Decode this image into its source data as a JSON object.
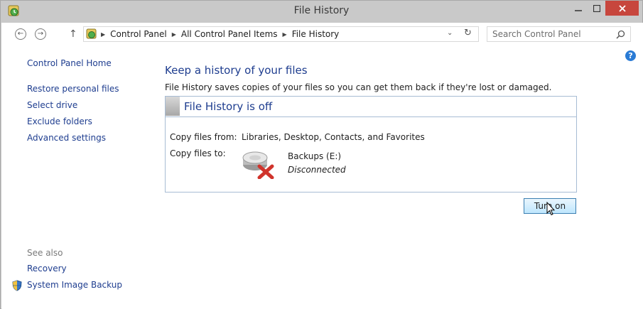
{
  "window": {
    "title": "File History"
  },
  "address": {
    "breadcrumbs": [
      "Control Panel",
      "All Control Panel Items",
      "File History"
    ],
    "search_placeholder": "Search Control Panel"
  },
  "sidebar": {
    "home": "Control Panel Home",
    "links": [
      "Restore personal files",
      "Select drive",
      "Exclude folders",
      "Advanced settings"
    ],
    "see_also_label": "See also",
    "see_also": [
      "Recovery",
      "System Image Backup"
    ]
  },
  "main": {
    "heading": "Keep a history of your files",
    "description": "File History saves copies of your files so you can get them back if they're lost or damaged.",
    "status_title": "File History is off",
    "copy_from_label": "Copy files from:",
    "copy_from_value": "Libraries, Desktop, Contacts, and Favorites",
    "copy_to_label": "Copy files to:",
    "drive_name": "Backups (E:)",
    "drive_status": "Disconnected",
    "turn_on_label": "Turn on"
  },
  "icons": {
    "app": "file-history-icon",
    "back": "back-arrow-icon",
    "forward": "forward-arrow-icon",
    "up": "up-arrow-icon",
    "refresh": "refresh-icon",
    "search": "search-icon",
    "help": "help-icon",
    "shield": "uac-shield-icon",
    "drive": "drive-disconnected-icon"
  },
  "colors": {
    "link": "#1e3d8f",
    "close_button": "#c7463d",
    "panel_border": "#a7bcd4",
    "error_x": "#d0332b"
  }
}
